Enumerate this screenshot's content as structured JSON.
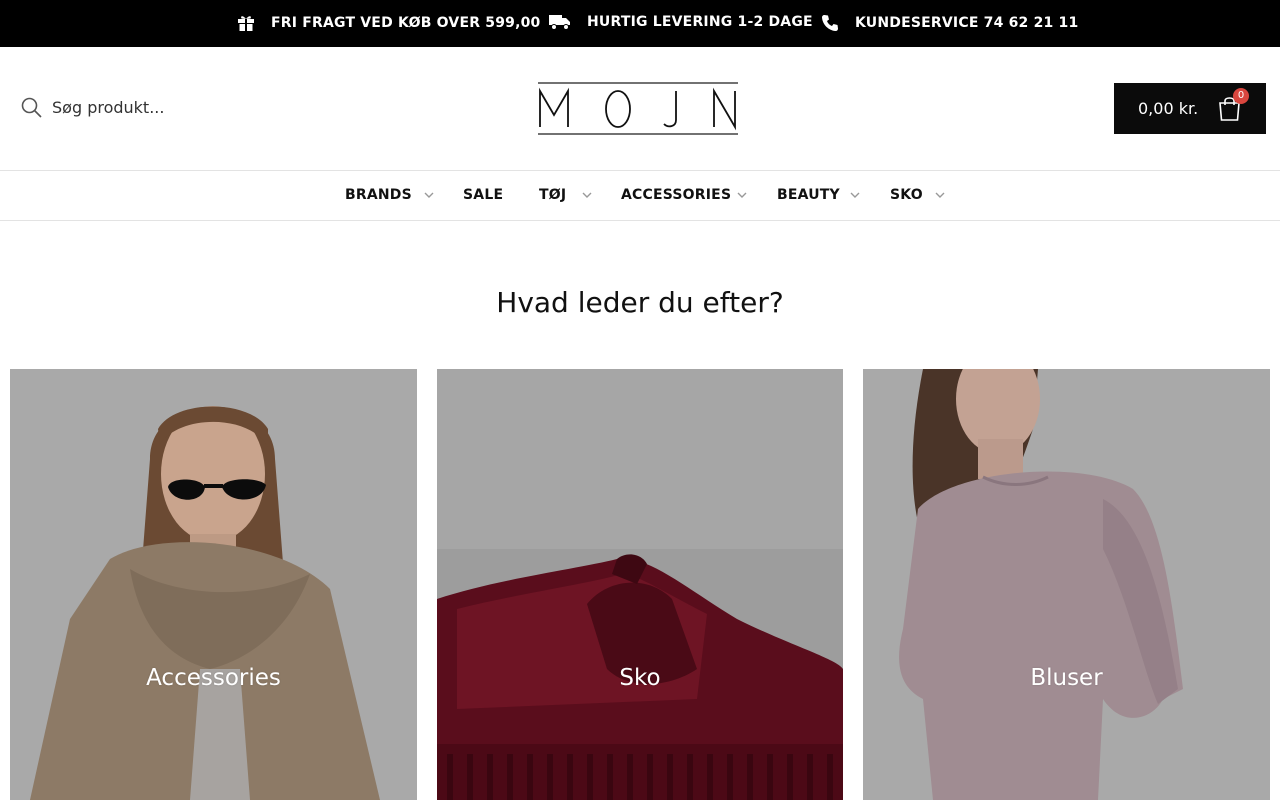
{
  "announcement": {
    "items": [
      {
        "icon": "gift-icon",
        "text": "FRI FRAGT VED KØB OVER 599,00"
      },
      {
        "icon": "truck-icon",
        "text": "HURTIG LEVERING 1-2 DAGE"
      },
      {
        "icon": "phone-icon",
        "text": "KUNDESERVICE 74 62 21 11"
      }
    ]
  },
  "header": {
    "search_placeholder": "Søg produkt...",
    "logo_text": "MOJN",
    "cart_amount": "0,00 kr.",
    "cart_count": "0"
  },
  "nav": {
    "items": [
      {
        "label": "BRANDS",
        "has_dropdown": true
      },
      {
        "label": "SALE",
        "has_dropdown": false
      },
      {
        "label": "TØJ",
        "has_dropdown": true
      },
      {
        "label": "ACCESSORIES",
        "has_dropdown": true
      },
      {
        "label": "BEAUTY",
        "has_dropdown": true
      },
      {
        "label": "SKO",
        "has_dropdown": true
      }
    ]
  },
  "main": {
    "headline": "Hvad leder du efter?",
    "categories": [
      {
        "label": "Accessories"
      },
      {
        "label": "Sko"
      },
      {
        "label": "Bluser"
      }
    ]
  },
  "colors": {
    "topbar": "#000000",
    "cart_bg": "#0b0b0b",
    "badge": "#d9463e"
  }
}
